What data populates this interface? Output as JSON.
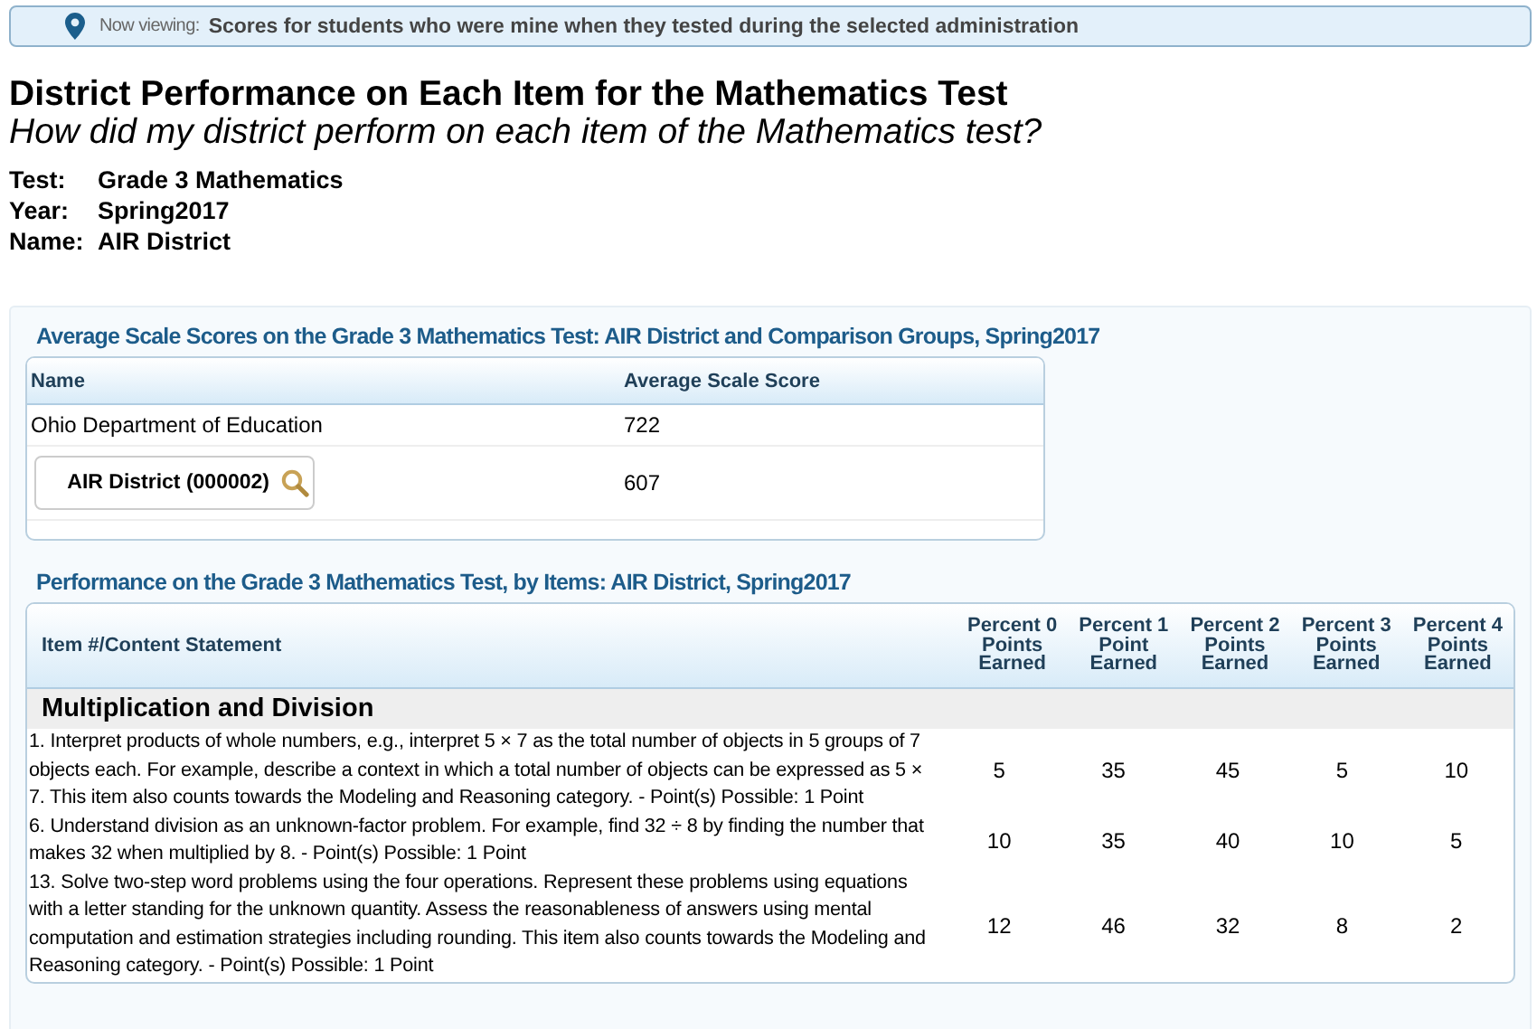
{
  "banner": {
    "label": "Now viewing:",
    "value": "Scores for students who were mine when they tested during the selected administration"
  },
  "title": "District Performance on Each Item for the Mathematics Test",
  "subtitle": "How did my district perform on each item of the Mathematics test?",
  "details": [
    {
      "label": "Test:",
      "value": "Grade 3 Mathematics"
    },
    {
      "label": "Year:",
      "value": "Spring2017"
    },
    {
      "label": "Name:",
      "value": "AIR District"
    }
  ],
  "scores_table": {
    "title": "Average Scale Scores on the Grade 3 Mathematics Test: AIR District and Comparison Groups, Spring2017",
    "columns": [
      "Name",
      "Average Scale Score"
    ],
    "rows": [
      {
        "kind": "text",
        "name": "Ohio Department of Education",
        "score": "722"
      },
      {
        "kind": "button",
        "name": "AIR District (000002)",
        "score": "607"
      }
    ]
  },
  "items_table": {
    "title": "Performance on the Grade 3 Mathematics Test, by Items: AIR District, Spring2017",
    "columns": [
      "Item #/Content Statement",
      "Percent 0 Points Earned",
      "Percent 1 Point Earned",
      "Percent 2 Points Earned",
      "Percent 3 Points Earned",
      "Percent 4 Points Earned"
    ],
    "groups": [
      {
        "title": "Multiplication and Division",
        "rows": [
          {
            "statement": "1. Interpret products of whole numbers, e.g., interpret 5 × 7 as the total number of objects in 5 groups of 7 objects each. For example, describe a context in which a total number of objects can be expressed as 5 × 7. This item also counts towards the Modeling and Reasoning category. - Point(s) Possible: 1 Point",
            "values": [
              "5",
              "35",
              "45",
              "5",
              "10"
            ]
          },
          {
            "statement": "6. Understand division as an unknown-factor problem. For example, find 32 ÷ 8 by finding the number that makes 32 when multiplied by 8. - Point(s) Possible: 1 Point",
            "values": [
              "10",
              "35",
              "40",
              "10",
              "5"
            ]
          },
          {
            "statement": "13. Solve two-step word problems using the four operations. Represent these problems using equations with a letter standing for the unknown quantity. Assess the reasonableness of answers using mental computation and estimation strategies including rounding. This item also counts towards the Modeling and Reasoning category. - Point(s) Possible: 1 Point",
            "values": [
              "12",
              "46",
              "32",
              "8",
              "2"
            ]
          }
        ]
      }
    ]
  }
}
